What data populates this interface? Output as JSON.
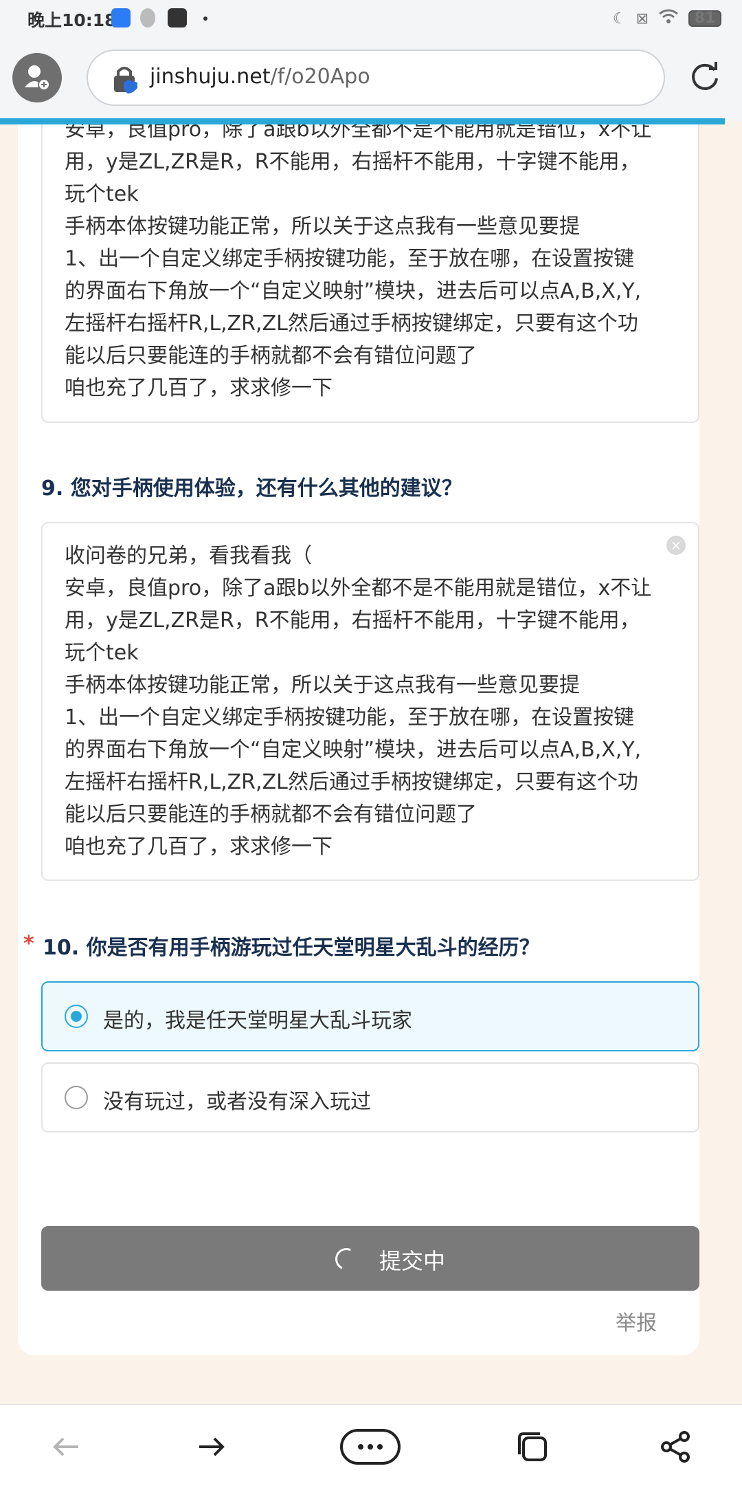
{
  "status_bar": {
    "time": "晚上10:18",
    "battery": "81"
  },
  "browser": {
    "url_host": "jinshuju.net",
    "url_path": "/f/o20Apo"
  },
  "form": {
    "prev_answer_text": "安卓，良值pro，除了a跟b以外全都不是不能用就是错位，x不让\n用，y是ZL,ZR是R，R不能用，右摇杆不能用，十字键不能用，\n玩个tek\n手柄本体按键功能正常，所以关于这点我有一些意见要提\n1、出一个自定义绑定手柄按键功能，至于放在哪，在设置按键\n的界面右下角放一个“自定义映射”模块，进去后可以点A,B,X,Y,\n左摇杆右摇杆R,L,ZR,ZL然后通过手柄按键绑定，只要有这个功\n能以后只要能连的手柄就都不会有错位问题了\n咱也充了几百了，求求修一下",
    "q9": {
      "title": "9. 您对手柄使用体验，还有什么其他的建议？",
      "answer": "收问卷的兄弟，看我看我（\n安卓，良值pro，除了a跟b以外全都不是不能用就是错位，x不让\n用，y是ZL,ZR是R，R不能用，右摇杆不能用，十字键不能用，\n玩个tek\n手柄本体按键功能正常，所以关于这点我有一些意见要提\n1、出一个自定义绑定手柄按键功能，至于放在哪，在设置按键\n的界面右下角放一个“自定义映射”模块，进去后可以点A,B,X,Y,\n左摇杆右摇杆R,L,ZR,ZL然后通过手柄按键绑定，只要有这个功\n能以后只要能连的手柄就都不会有错位问题了\n咱也充了几百了，求求修一下"
    },
    "q10": {
      "required_mark": "*",
      "title": "10. 你是否有用手柄游玩过任天堂明星大乱斗的经历？",
      "options": [
        {
          "label": "是的，我是任天堂明星大乱斗玩家",
          "selected": true
        },
        {
          "label": "没有玩过，或者没有深入玩过",
          "selected": false
        }
      ]
    },
    "submit_label": "提交中",
    "report_label": "举报"
  },
  "colors": {
    "accent": "#2aa9d8",
    "required": "#e54a3e",
    "submit_bg": "#7a7a7a",
    "page_bg": "#fbf3e9"
  },
  "icons": {
    "back": "arrow-left-icon",
    "forward": "arrow-right-icon",
    "menu": "more-dots-icon",
    "tabs": "tabs-icon",
    "share": "share-icon"
  }
}
